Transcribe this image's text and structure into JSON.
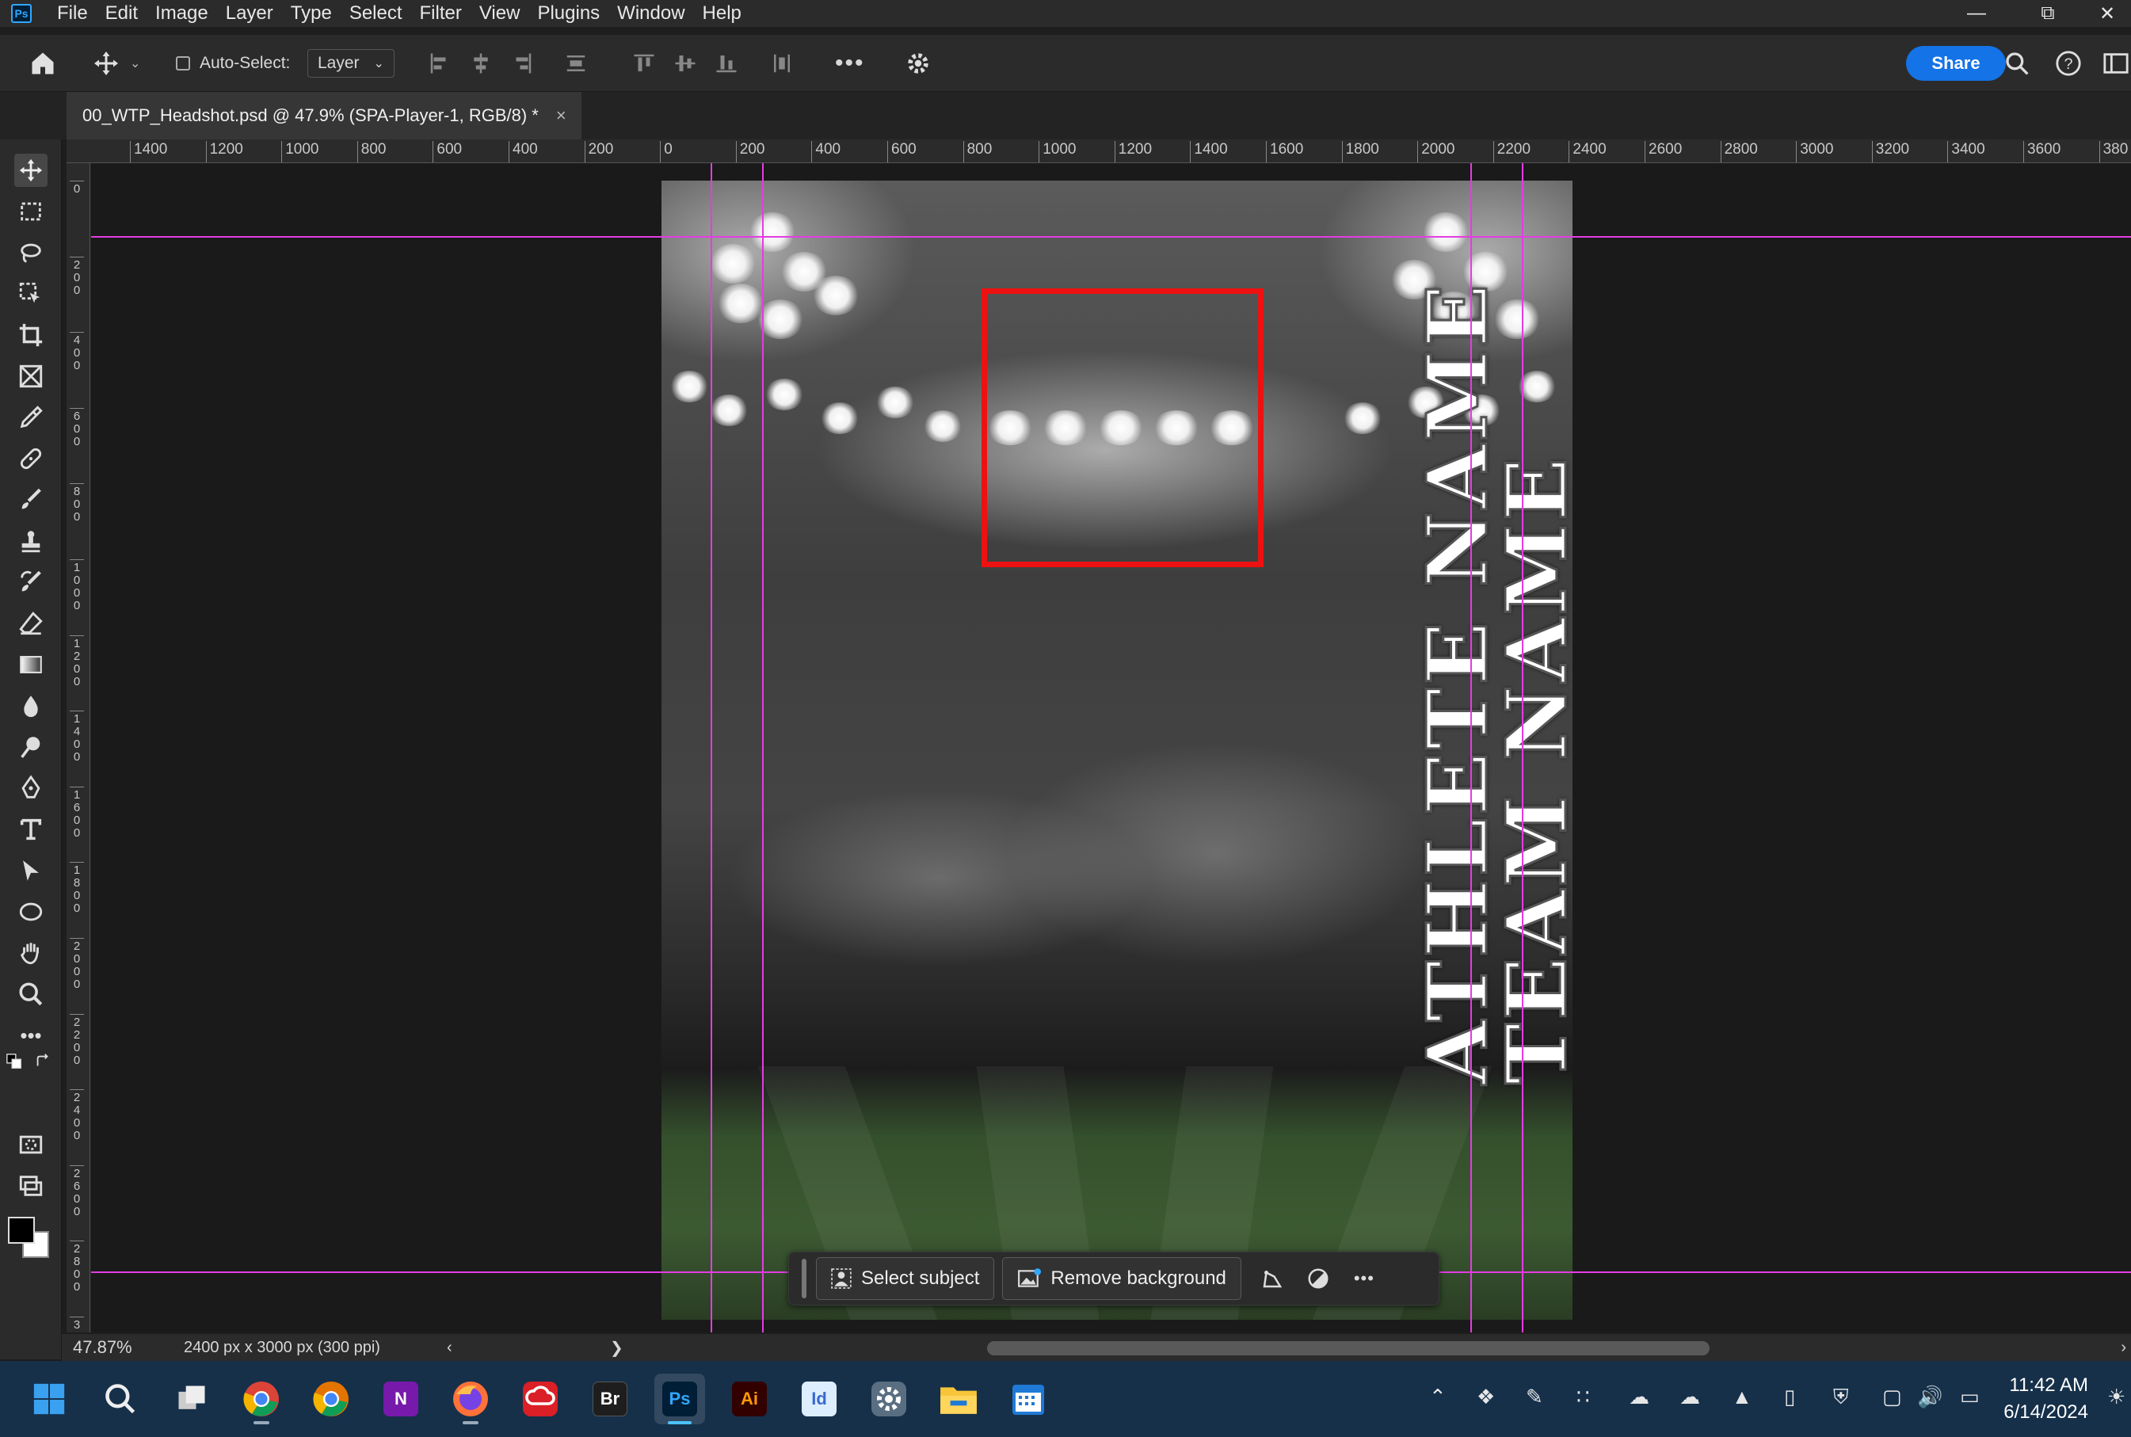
{
  "app": {
    "logo": "Ps",
    "menu": [
      "File",
      "Edit",
      "Image",
      "Layer",
      "Type",
      "Select",
      "Filter",
      "View",
      "Plugins",
      "Window",
      "Help"
    ]
  },
  "window_controls": {
    "minimize": "—",
    "restore": "⧉",
    "close": "✕"
  },
  "options_bar": {
    "auto_select_label": "Auto-Select:",
    "auto_select_checked": false,
    "layer_select_value": "Layer",
    "share_label": "Share"
  },
  "document_tab": {
    "title": "00_WTP_Headshot.psd @ 47.9% (SPA-Player-1, RGB/8) *",
    "close": "×"
  },
  "ruler_top_labels": [
    "1400",
    "1200",
    "1000",
    "800",
    "600",
    "400",
    "200",
    "0",
    "200",
    "400",
    "600",
    "800",
    "1000",
    "1200",
    "1400",
    "1600",
    "1800",
    "2000",
    "2200",
    "2400",
    "2600",
    "2800",
    "3000",
    "3200",
    "3400",
    "3600",
    "380"
  ],
  "ruler_left_labels": [
    "0",
    "2\n0\n0",
    "4\n0\n0",
    "6\n0\n0",
    "8\n0\n0",
    "1\n0\n0\n0",
    "1\n2\n0\n0",
    "1\n4\n0\n0",
    "1\n6\n0\n0",
    "1\n8\n0\n0",
    "2\n0\n0\n0",
    "2\n2\n0\n0",
    "2\n4\n0\n0",
    "2\n6\n0\n0",
    "2\n8\n0\n0",
    "3"
  ],
  "canvas": {
    "athlete_name": "ATHLETE NAME",
    "team_name": "TEAM NAME",
    "frame_color": "#ee1111",
    "guide_color": "#e43ce4"
  },
  "context_bar": {
    "select_subject_label": "Select subject",
    "remove_background_label": "Remove background",
    "more": "•••"
  },
  "status": {
    "zoom": "47.87%",
    "doc_size": "2400 px x 3000 px (300 ppi)",
    "arrow": "❯",
    "scroll_left": "‹",
    "scroll_right": "›"
  },
  "taskbar": {
    "apps": [
      {
        "name": "start-icon"
      },
      {
        "name": "search-icon"
      },
      {
        "name": "task-view-icon"
      },
      {
        "name": "chrome-icon"
      },
      {
        "name": "chrome-canary-icon"
      },
      {
        "name": "onenote-icon",
        "label": "N"
      },
      {
        "name": "firefox-icon"
      },
      {
        "name": "creative-cloud-icon"
      },
      {
        "name": "bridge-icon",
        "label": "Br"
      },
      {
        "name": "photoshop-icon",
        "label": "Ps"
      },
      {
        "name": "illustrator-icon",
        "label": "Ai"
      },
      {
        "name": "indesign-icon",
        "label": "Id"
      },
      {
        "name": "settings-icon"
      },
      {
        "name": "file-explorer-icon"
      },
      {
        "name": "calendar-icon"
      }
    ],
    "time": "11:42 AM",
    "date": "6/14/2024"
  }
}
